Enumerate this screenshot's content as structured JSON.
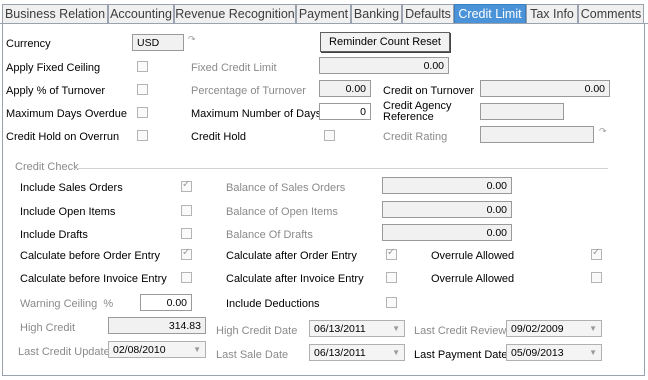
{
  "tabs": [
    "Business Relation",
    "Accounting",
    "Revenue Recognition",
    "Payment",
    "Banking",
    "Defaults",
    "Credit Limit",
    "Tax Info",
    "Comments"
  ],
  "active_tab": "Credit Limit",
  "form": {
    "currency_label": "Currency",
    "currency_value": "USD",
    "reminder_button": "Reminder Count Reset",
    "apply_fixed_ceiling": "Apply Fixed Ceiling",
    "fixed_credit_limit_label": "Fixed Credit Limit",
    "fixed_credit_limit_value": "0.00",
    "apply_pct_turnover": "Apply % of Turnover",
    "pct_turnover_label": "Percentage of Turnover",
    "pct_turnover_value": "0.00",
    "credit_on_turnover_label": "Credit on Turnover",
    "credit_on_turnover_value": "0.00",
    "max_days_overdue": "Maximum Days Overdue",
    "max_num_days_label": "Maximum Number of Days",
    "max_num_days_value": "0",
    "credit_agency_label_1": "Credit Agency",
    "credit_agency_label_2": "Reference",
    "credit_agency_value": "",
    "credit_hold_on_overrun": "Credit Hold on Overrun",
    "credit_hold_label": "Credit Hold",
    "credit_rating_label": "Credit Rating",
    "credit_rating_value": ""
  },
  "credit_check": {
    "title": "Credit Check",
    "include_sales_orders": "Include Sales Orders",
    "include_open_items": "Include Open Items",
    "include_drafts": "Include Drafts",
    "calc_before_order": "Calculate before Order Entry",
    "calc_before_invoice": "Calculate before Invoice Entry",
    "balance_sales_orders_label": "Balance of Sales Orders",
    "balance_sales_orders_value": "0.00",
    "balance_open_items_label": "Balance of Open Items",
    "balance_open_items_value": "0.00",
    "balance_drafts_label": "Balance Of Drafts",
    "balance_drafts_value": "0.00",
    "calc_after_order": "Calculate after Order Entry",
    "calc_after_invoice": "Calculate after Invoice Entry",
    "overrule_allowed_1": "Overrule Allowed",
    "overrule_allowed_2": "Overrule Allowed",
    "warning_ceiling_label": "Warning Ceiling  %",
    "warning_ceiling_value": "0.00",
    "include_deductions": "Include Deductions",
    "high_credit_label": "High Credit",
    "high_credit_value": "314.83",
    "high_credit_date_label": "High Credit Date",
    "high_credit_date_value": "06/13/2011",
    "last_credit_review_label": "Last Credit Review",
    "last_credit_review_value": "09/02/2009",
    "last_credit_update_label": "Last Credit Update",
    "last_credit_update_value": "02/08/2010",
    "last_sale_date_label": "Last Sale Date",
    "last_sale_date_value": "06/13/2011",
    "last_payment_date_label": "Last Payment Date",
    "last_payment_date_value": "05/09/2013"
  },
  "colors": {
    "active_tab": "#4a93d8",
    "border": "#9aa3ad",
    "field_bg": "#f1f1f1",
    "disabled_text": "#8a8a8a"
  },
  "icons": {
    "dropdown": "chevron-down-icon",
    "link": "link-icon",
    "checkbox_check": "checkmark-icon"
  }
}
